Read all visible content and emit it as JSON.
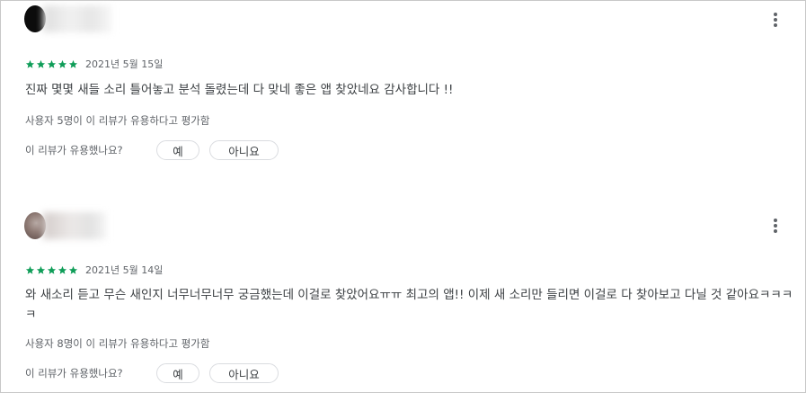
{
  "colors": {
    "star": "#0f9d58",
    "text": "#3c4043",
    "secondary": "#5f6368",
    "pill_border": "#dadce0"
  },
  "reviews": [
    {
      "rating": 5,
      "date": "2021년 5월 15일",
      "text": "진짜 몇몇 새들 소리 틀어놓고 분석 돌렸는데 다 맞네 좋은 앱 찾았네요 감사합니다 !!",
      "helpful_count_text": "사용자 5명이 이 리뷰가 유용하다고 평가함",
      "question": "이 리뷰가 유용했나요?",
      "yes_label": "예",
      "no_label": "아니요"
    },
    {
      "rating": 5,
      "date": "2021년 5월 14일",
      "text": "와 새소리 듣고 무슨 새인지 너무너무너무 궁금했는데 이걸로 찾았어요ㅠㅠ 최고의 앱!! 이제 새 소리만 들리면 이걸로 다 찾아보고 다닐 것 같아요ㅋㅋㅋㅋ",
      "helpful_count_text": "사용자 8명이 이 리뷰가 유용하다고 평가함",
      "question": "이 리뷰가 유용했나요?",
      "yes_label": "예",
      "no_label": "아니요"
    }
  ],
  "icons": {
    "more": "more-vert-icon",
    "star": "star-icon"
  }
}
